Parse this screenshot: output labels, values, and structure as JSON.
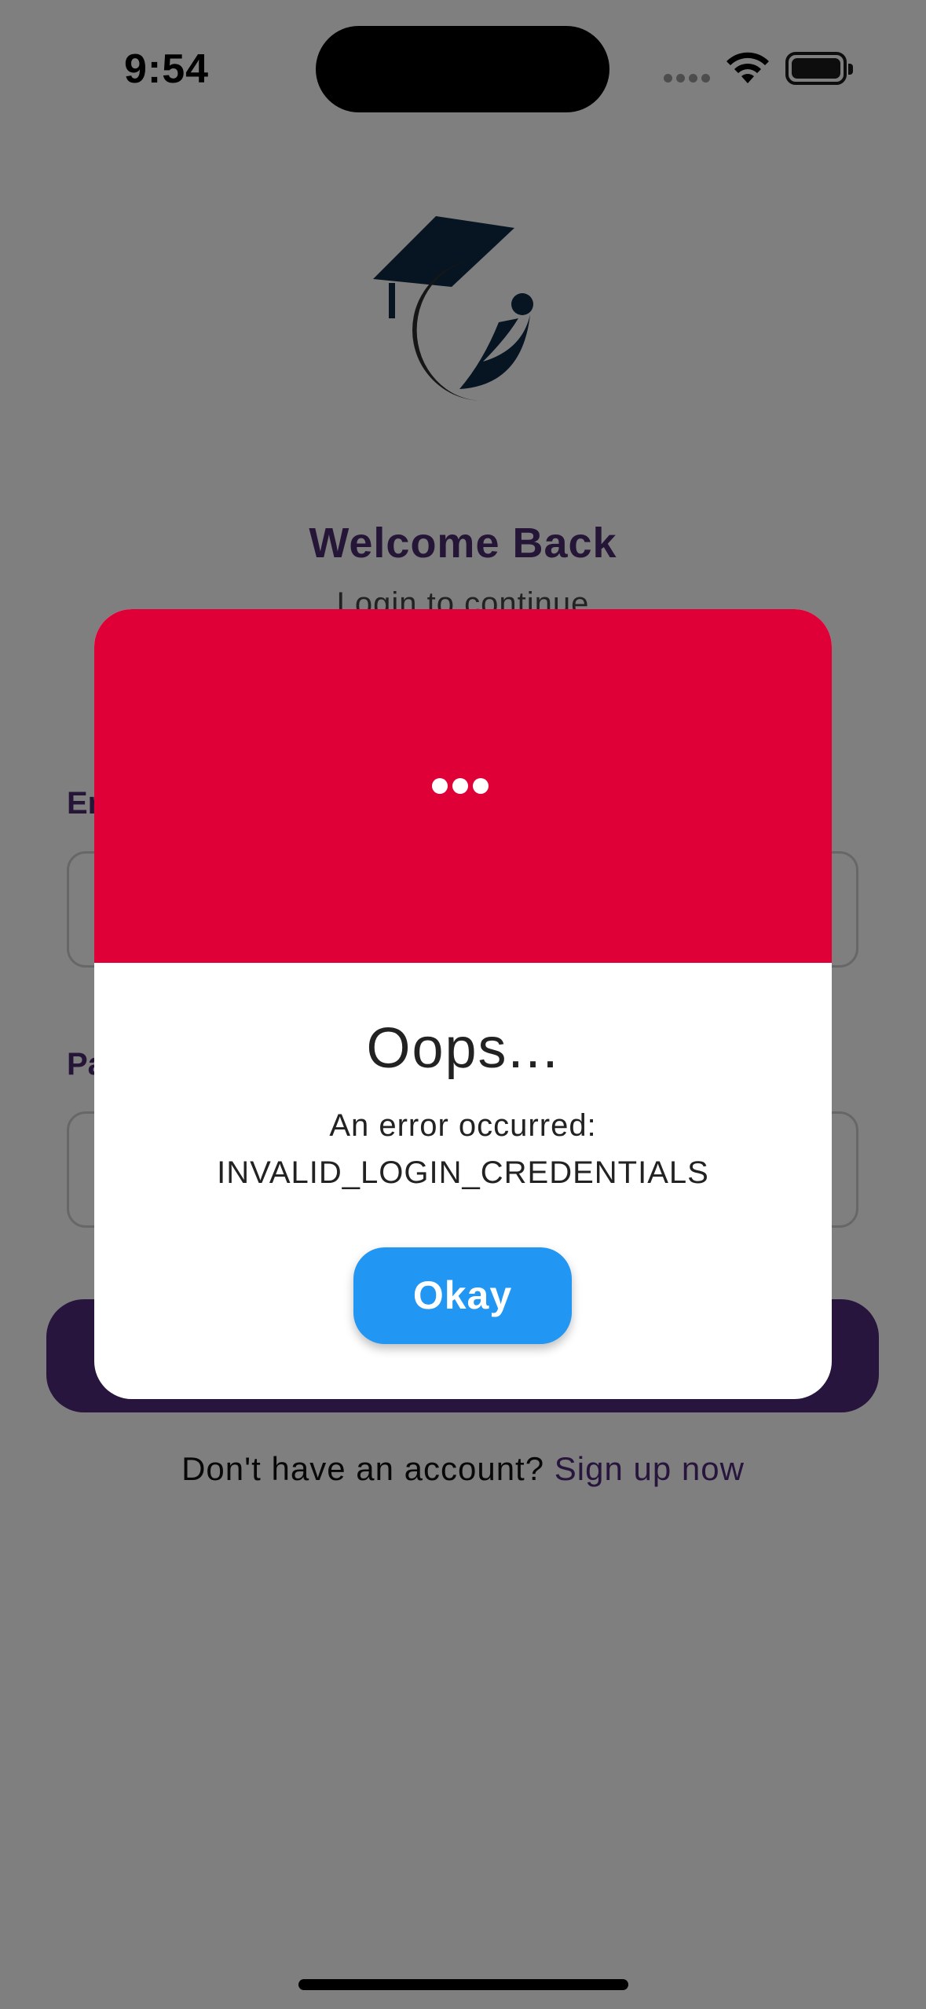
{
  "status_bar": {
    "time": "9:54",
    "icons": [
      "cellular-signal-icon",
      "wifi-icon",
      "battery-icon"
    ]
  },
  "login": {
    "logo_icon": "graduation-cap-logo-icon",
    "title": "Welcome Back",
    "subtitle": "Login to continue",
    "email_label_visible": "Em",
    "password_label_visible": "Pa",
    "email_value": "",
    "password_value": "",
    "login_button_label": "",
    "signup_prompt": "Don't have an account?",
    "signup_link": "Sign up now"
  },
  "dialog": {
    "header_icon": "ellipsis-icon",
    "title": "Oops...",
    "message_line1": "An error occurred:",
    "message_line2": "INVALID_LOGIN_CREDENTIALS",
    "okay_label": "Okay"
  },
  "colors": {
    "accent_purple": "#4f2a7a",
    "dialog_header_red": "#df0038",
    "okay_blue": "#2196f3"
  }
}
